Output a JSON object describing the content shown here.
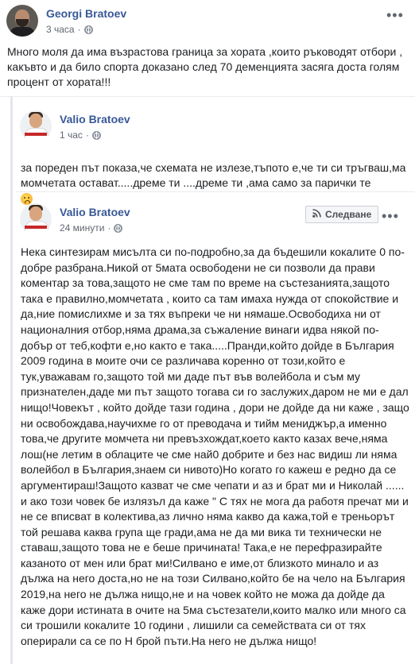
{
  "post1": {
    "author": "Georgi Bratoev",
    "time": "3 часа",
    "text": "Много моля да има възрастова граница за хората ,които ръководят отбори , какъвто и да било спорта доказано след 70 деменцията засяга доста голям процент от хората!!!"
  },
  "post2": {
    "author": "Valio Bratoev",
    "time": "1 час",
    "text": "за пореден път показа,че схемата не излезе,тъпото е,че ти си тръгваш,ма момчетата остават.....дреме ти ....дреме ти ,ама само за парички те"
  },
  "post3": {
    "author": "Valio Bratoev",
    "time": "24 минути",
    "follow_label": "Следване",
    "text": "Нека синтезирам мисълта си по-подробно,за да бъдешили кокалите 0 по-добре разбрана.Никой от 5мата освободени не си позволи да прави коментар за това,защото не сме там по време на състезанията,защото така е правилно,момчетата , които са там имаха нужда от спокойствие и да,ние помислихме и за тях въпреки че ни нямаше.Освободиха ни от националния отбор,няма драма,за съжаление винаги идва някой по-добър от теб,кофти е,но както е така.....Пранди,който дойде в България 2009 година в моите очи се различава коренно от този,който е тук,уважавам го,защото той ми даде път във волейбола и съм му признателен,даде ми път защото тогава си го заслужих,даром не ми е дал нищо!Човекът , който дойде тази година , дори не дойде да ни каже , защо ни освобождава,научихме го от преводача и тийм мениджър,а именно това,че другите момчета ни превъзхождат,което както казах вече,няма лош(не летим в облаците че сме най0 добрите и без нас видиш ли няма волейбол в България,знаем си нивото)Но когато го кажеш е редно да се аргументираш!Защото казват че сме чепати и аз и брат ми и Николай ...... и ако този човек бе излязъл да каже \" С тях не мога да работя пречат ми и не се вписват в колектива,аз лично няма какво да кажа,той е треньорът той решава каква група ще гради,ама не да ми вика ти технически не ставаш,защото това не е беше причината! Така,е не перефразирайте казаното от мен или брат ми!Силвано е име,от близкото минало и аз дължа на него доста,но не на този Силвано,който бе на чело на България 2019,на него не дължа нищо,не и на човек който не можа да дойде да каже дори истината в очите на 5ма състезатели,които малко или много са си трошили кокалите 10 години , лишили са семействата си от тях оперирали са се по Н брой пъти.На него не дължа нищо!"
  },
  "icons": {
    "globe": "globe-icon",
    "more": "more-options-icon",
    "follow": "rss-follow-icon",
    "emoji": "disappointed-emoji"
  },
  "colors": {
    "name": "#385898",
    "text": "#1c1e21",
    "meta": "#616770"
  }
}
